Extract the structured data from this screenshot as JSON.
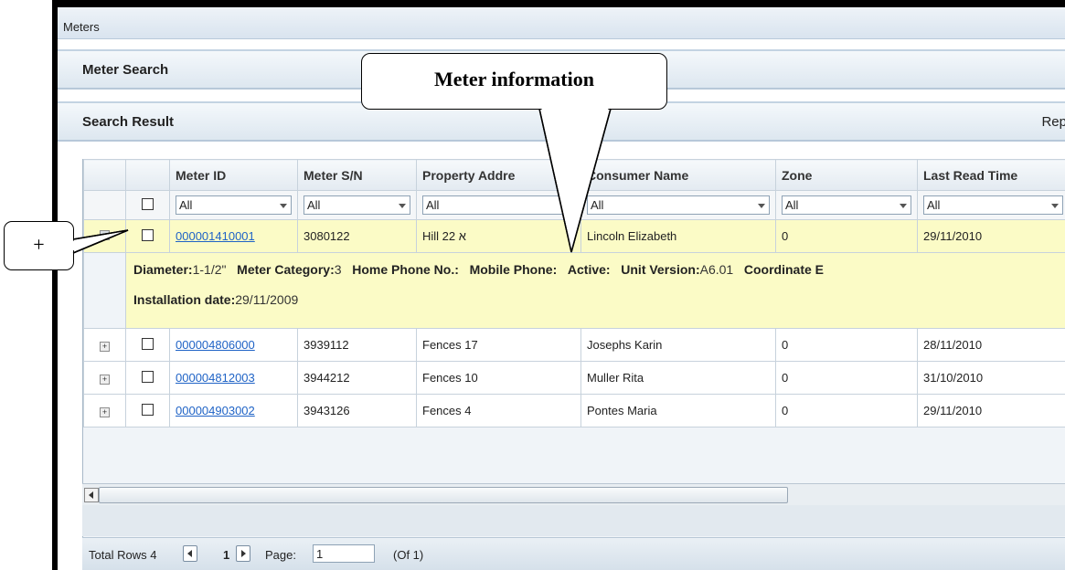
{
  "window": {
    "title": "Meters"
  },
  "meter_search": {
    "title": "Meter Search"
  },
  "search_result": {
    "title": "Search Result",
    "right_link": "Rep"
  },
  "callouts": {
    "meter_info": "Meter information",
    "expand": "+"
  },
  "table": {
    "columns": [
      "Meter ID",
      "Meter S/N",
      "Property Addre",
      "Consumer Name",
      "Zone",
      "Last Read Time"
    ],
    "filters": [
      "All",
      "All",
      "All",
      "All",
      "All",
      "All"
    ],
    "rows": [
      {
        "meter_id": "000001410001",
        "sn": "3080122",
        "address": "Hill 22 א",
        "consumer": "Lincoln Elizabeth",
        "zone": "0",
        "last_read": "29/11/2010",
        "selected": true
      },
      {
        "meter_id": "000004806000",
        "sn": "3939112",
        "address": "Fences 17",
        "consumer": "Josephs Karin",
        "zone": "0",
        "last_read": "28/11/2010",
        "selected": false
      },
      {
        "meter_id": "000004812003",
        "sn": "3944212",
        "address": "Fences 10",
        "consumer": "Muller Rita",
        "zone": "0",
        "last_read": "31/10/2010",
        "selected": false
      },
      {
        "meter_id": "000004903002",
        "sn": "3943126",
        "address": "Fences 4",
        "consumer": "Pontes Maria",
        "zone": "0",
        "last_read": "29/11/2010",
        "selected": false
      }
    ],
    "detail": {
      "diameter_label": "Diameter:",
      "diameter_value": "1-1/2\"",
      "category_label": "Meter Category:",
      "category_value": "3",
      "home_phone_label": "Home Phone No.:",
      "mobile_label": "Mobile Phone:",
      "active_label": "Active:",
      "unit_label": "Unit Version:",
      "unit_value": "A6.01",
      "coord_label": "Coordinate E",
      "install_label": "Installation date:",
      "install_value": "29/11/2009"
    }
  },
  "pager": {
    "total_label": "Total Rows 4",
    "current_page": "1",
    "page_label": "Page:",
    "page_value": "1",
    "of_label": "(Of 1)"
  }
}
